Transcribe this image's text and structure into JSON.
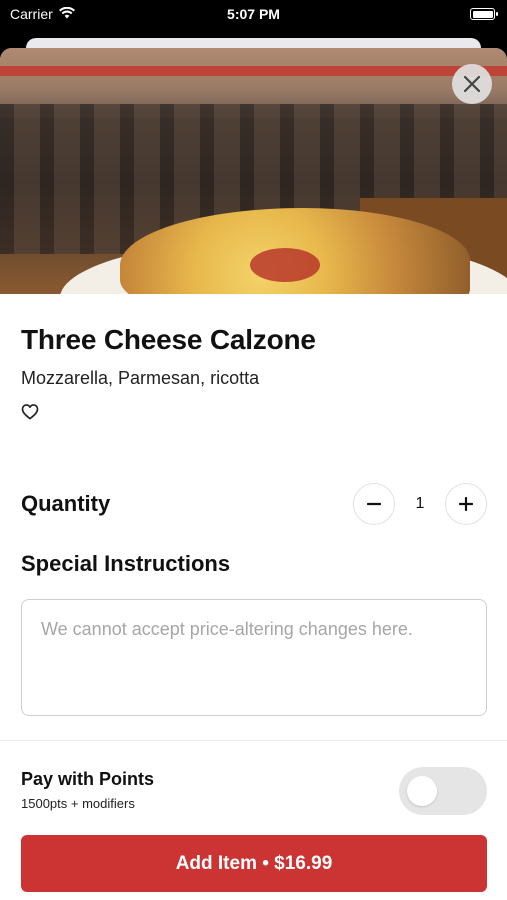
{
  "status_bar": {
    "carrier": "Carrier",
    "time": "5:07 PM",
    "icons": [
      "wifi-icon",
      "battery-icon"
    ]
  },
  "item": {
    "name": "Three Cheese Calzone",
    "description": "Mozzarella, Parmesan, ricotta",
    "favorite_icon": "heart-outline-icon"
  },
  "quantity": {
    "label": "Quantity",
    "value": "1",
    "decrement_icon": "minus-icon",
    "increment_icon": "plus-icon"
  },
  "instructions": {
    "label": "Special Instructions",
    "placeholder": "We cannot accept price-altering changes here.",
    "value": ""
  },
  "points": {
    "title": "Pay with Points",
    "subtitle": "1500pts + modifiers",
    "enabled": false
  },
  "add_button": {
    "label": "Add Item • $16.99"
  },
  "colors": {
    "accent": "#cc3333",
    "toggle_off": "#e5e5e5",
    "border": "#cfcfcf",
    "placeholder": "#a6a6a6"
  }
}
